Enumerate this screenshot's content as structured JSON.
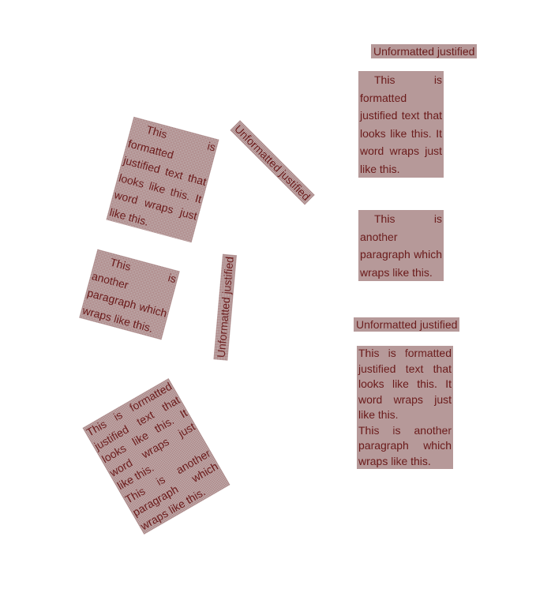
{
  "texts": {
    "heading": "Unformatted justified",
    "para1": "This is formatted justified text that looks like this. It word wraps just like this.",
    "para2": "This is another paragraph which wraps like this."
  }
}
